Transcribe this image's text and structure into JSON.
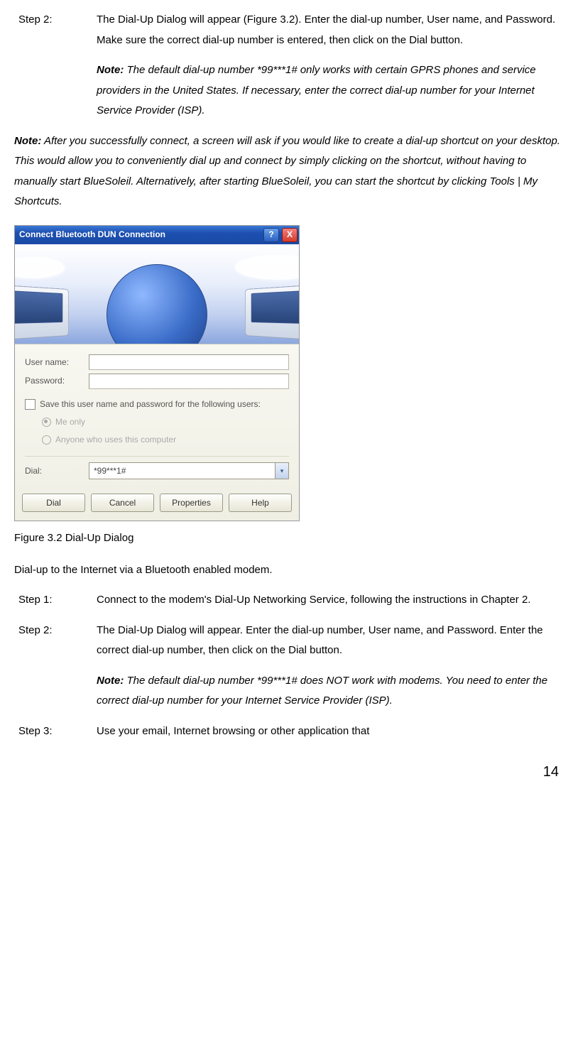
{
  "page_number": "14",
  "top_step": {
    "label": "Step 2:",
    "body": "The Dial-Up Dialog will appear (Figure 3.2). Enter the dial-up number, User name, and Password. Make sure the correct dial-up number is entered, then click on the Dial button.",
    "note_label": "Note:",
    "note_body": " The default dial-up number *99***1# only works with certain GPRS phones and service providers in the United States. If necessary, enter the correct dial-up number for your Internet Service Provider (ISP)."
  },
  "outer_note": {
    "label": "Note:",
    "body": " After you successfully connect, a screen will ask if you would like to create a dial-up shortcut on your desktop. This would allow you to conveniently dial up and connect by simply clicking on the shortcut, without having to manually start BlueSoleil. Alternatively, after starting BlueSoleil, you can start the shortcut by clicking Tools | My Shortcuts."
  },
  "dialog": {
    "title": "Connect Bluetooth DUN Connection",
    "help_glyph": "?",
    "close_glyph": "X",
    "username_label": "User name:",
    "password_label": "Password:",
    "save_label": "Save this user name and password for the following users:",
    "radio_me": "Me only",
    "radio_anyone": "Anyone who uses this computer",
    "dial_label": "Dial:",
    "dial_value": "*99***1#",
    "combo_arrow": "▾",
    "buttons": {
      "dial": "Dial",
      "cancel": "Cancel",
      "properties": "Properties",
      "help": "Help"
    }
  },
  "figure_caption": "Figure 3.2 Dial-Up Dialog",
  "subheading": "Dial-up to the Internet via a Bluetooth enabled modem.",
  "steps": [
    {
      "label": "Step 1:",
      "body": "Connect to the modem's Dial-Up Networking Service, following the instructions in Chapter 2."
    },
    {
      "label": "Step 2:",
      "body": "The Dial-Up Dialog will appear. Enter the dial-up number, User name, and Password. Enter the correct dial-up number, then click on the Dial button.",
      "note_label": "Note:",
      "note_body": " The default dial-up number *99***1# does NOT work with modems. You need to enter the correct dial-up number for your Internet Service Provider (ISP)."
    },
    {
      "label": "Step 3:",
      "body": "Use your email, Internet browsing or other application that"
    }
  ]
}
